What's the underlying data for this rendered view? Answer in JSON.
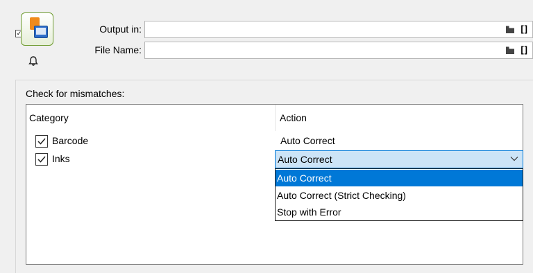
{
  "header": {
    "output_in_label": "Output in:",
    "output_in_value": "",
    "file_name_label": "File Name:",
    "file_name_value": "",
    "brackets": "[]"
  },
  "group": {
    "title": "Check for mismatches:"
  },
  "table": {
    "columns": [
      "Category",
      "Action"
    ],
    "rows": [
      {
        "category": "Barcode",
        "checked": true,
        "action": "Auto Correct"
      },
      {
        "category": "Inks",
        "checked": true,
        "action": "Auto Correct"
      }
    ]
  },
  "dropdown": {
    "selected": "Auto Correct",
    "options": [
      "Auto Correct",
      "Auto Correct (Strict Checking)",
      "Stop with Error"
    ]
  },
  "colors": {
    "selection": "#0078d7",
    "combo_bg": "#cce4f7"
  }
}
